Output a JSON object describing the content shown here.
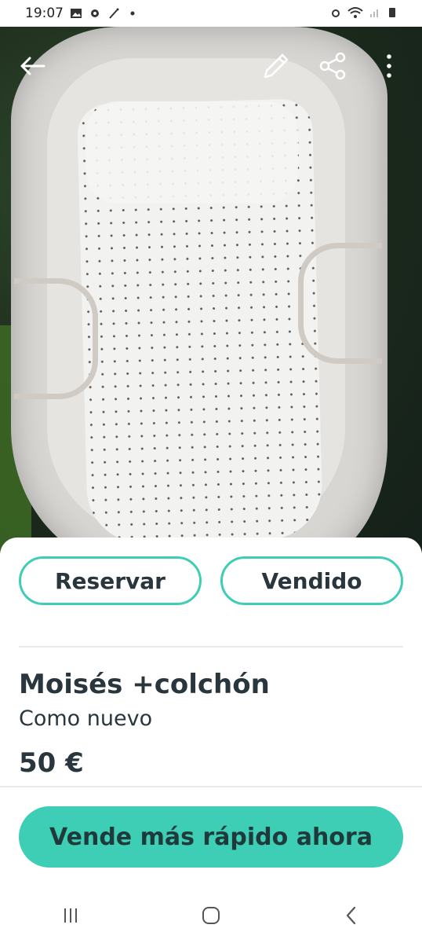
{
  "status_bar": {
    "time": "19:07",
    "left_icons": [
      "gallery-icon",
      "gear-icon",
      "magic-wand-icon",
      "dot-icon"
    ],
    "right_icons": [
      "alarm-icon",
      "wifi-icon",
      "signal-icon",
      "battery-icon"
    ]
  },
  "photo": {
    "top_icons": [
      "back-arrow-icon",
      "edit-pencil-icon",
      "share-icon",
      "more-vertical-icon"
    ],
    "carousel": {
      "count": 4,
      "active_index": 1
    }
  },
  "actions": {
    "reserve_label": "Reservar",
    "sold_label": "Vendido"
  },
  "listing": {
    "title": "Moisés +colchón",
    "condition": "Como nuevo",
    "price": "50 €"
  },
  "cta": {
    "label": "Vende más rápido ahora"
  },
  "colors": {
    "accent": "#3ecdb5",
    "text": "#29363d"
  },
  "navbar": {
    "icons": [
      "recent-apps-icon",
      "home-icon",
      "back-icon"
    ]
  }
}
